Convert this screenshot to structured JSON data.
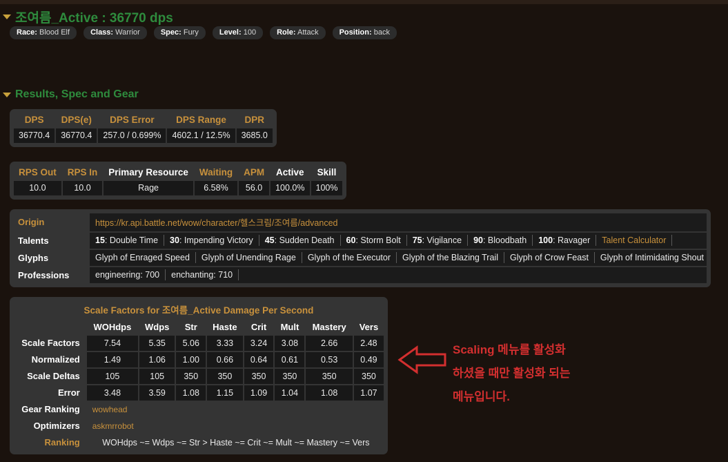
{
  "colors": {
    "background": "#1a120d",
    "accent_amber": "#c8913c",
    "accent_green": "#2e8b3d",
    "panel": "#343434",
    "cell": "#181818",
    "annotation_red": "#d32f2f"
  },
  "header": {
    "collapse_icon": "triangle-down-icon",
    "title": "조여름_Active : 36770 dps",
    "badges": [
      {
        "label": "Race:",
        "value": "Blood Elf"
      },
      {
        "label": "Class:",
        "value": "Warrior"
      },
      {
        "label": "Spec:",
        "value": "Fury"
      },
      {
        "label": "Level:",
        "value": "100"
      },
      {
        "label": "Role:",
        "value": "Attack"
      },
      {
        "label": "Position:",
        "value": "back"
      }
    ]
  },
  "results_section": {
    "collapse_icon": "triangle-down-icon",
    "title": "Results, Spec and Gear",
    "dps_table": {
      "headers": [
        "DPS",
        "DPS(e)",
        "DPS Error",
        "DPS Range",
        "DPR"
      ],
      "values": [
        "36770.4",
        "36770.4",
        "257.0 / 0.699%",
        "4602.1 / 12.5%",
        "3685.0"
      ]
    },
    "rps_table": {
      "headers": [
        "RPS Out",
        "RPS In",
        "Primary Resource",
        "Waiting",
        "APM",
        "Active",
        "Skill"
      ],
      "header_colors": [
        "amber",
        "amber",
        "white",
        "amber",
        "amber",
        "white",
        "white"
      ],
      "values": [
        "10.0",
        "10.0",
        "Rage",
        "6.58%",
        "56.0",
        "100.0%",
        "100%"
      ]
    }
  },
  "info_table": {
    "origin": {
      "label": "Origin",
      "url": "https://kr.api.battle.net/wow/character/헬스크림/조여름/advanced"
    },
    "talents": {
      "label": "Talents",
      "items": [
        {
          "tier": "15",
          "name": ": Double Time"
        },
        {
          "tier": "30",
          "name": ": Impending Victory"
        },
        {
          "tier": "45",
          "name": ": Sudden Death"
        },
        {
          "tier": "60",
          "name": ": Storm Bolt"
        },
        {
          "tier": "75",
          "name": ": Vigilance"
        },
        {
          "tier": "90",
          "name": ": Bloodbath"
        },
        {
          "tier": "100",
          "name": ": Ravager"
        }
      ],
      "calculator_link": "Talent Calculator"
    },
    "glyphs": {
      "label": "Glyphs",
      "items": [
        "Glyph of Enraged Speed",
        "Glyph of Unending Rage",
        "Glyph of the Executor",
        "Glyph of the Blazing Trail",
        "Glyph of Crow Feast",
        "Glyph of Intimidating Shout"
      ]
    },
    "professions": {
      "label": "Professions",
      "items": [
        "engineering: 700",
        "enchanting: 710"
      ]
    }
  },
  "scale_factors": {
    "title": "Scale Factors for 조여름_Active Damage Per Second",
    "columns": [
      "WOHdps",
      "Wdps",
      "Str",
      "Haste",
      "Crit",
      "Mult",
      "Mastery",
      "Vers"
    ],
    "rows": [
      {
        "label": "Scale Factors",
        "values": [
          "7.54",
          "5.35",
          "5.06",
          "3.33",
          "3.24",
          "3.08",
          "2.66",
          "2.48"
        ]
      },
      {
        "label": "Normalized",
        "values": [
          "1.49",
          "1.06",
          "1.00",
          "0.66",
          "0.64",
          "0.61",
          "0.53",
          "0.49"
        ]
      },
      {
        "label": "Scale Deltas",
        "values": [
          "105",
          "105",
          "350",
          "350",
          "350",
          "350",
          "350",
          "350"
        ]
      },
      {
        "label": "Error",
        "values": [
          "3.48",
          "3.59",
          "1.08",
          "1.15",
          "1.09",
          "1.04",
          "1.08",
          "1.07"
        ]
      }
    ],
    "gear_ranking": {
      "label": "Gear Ranking",
      "value": "wowhead"
    },
    "optimizers": {
      "label": "Optimizers",
      "value": "askmrrobot"
    },
    "ranking": {
      "label": "Ranking",
      "value": "WOHdps ~= Wdps ~= Str > Haste ~= Crit ~= Mult ~= Mastery ~= Vers"
    }
  },
  "annotation": {
    "arrow_icon": "arrow-left-icon",
    "lines": [
      "Scaling 메뉴를 활성화",
      "하셨을 때만 활성화 되는",
      "메뉴입니다."
    ]
  }
}
